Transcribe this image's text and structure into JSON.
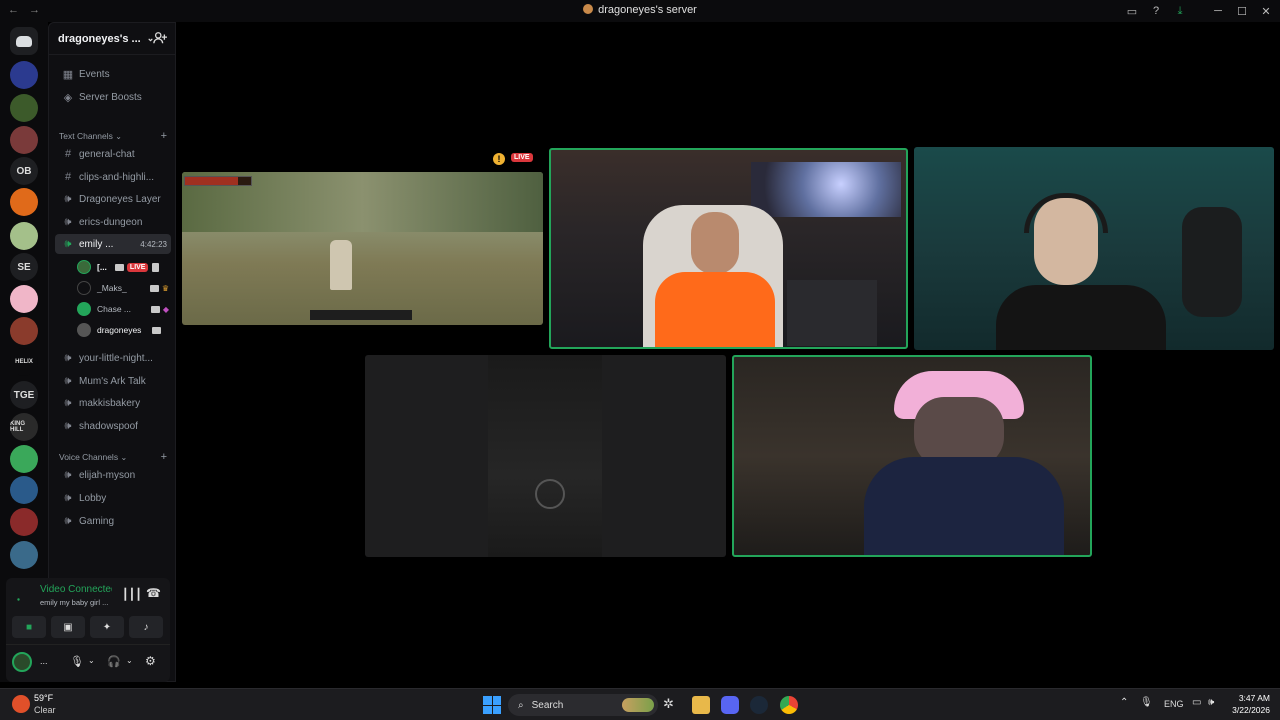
{
  "window": {
    "title": "dragoneyes's server",
    "back": "←",
    "forward": "→"
  },
  "guilds": [
    {
      "label": "",
      "color": "#5865f2"
    },
    {
      "label": "",
      "color": "#2b3a8f"
    },
    {
      "label": "",
      "color": "#3c5a2a"
    },
    {
      "label": "",
      "color": "#7a3a3a"
    },
    {
      "label": "OB",
      "color": "#1e1f22"
    },
    {
      "label": "",
      "color": "#e06a1a"
    },
    {
      "label": "",
      "color": "#a4c08a"
    },
    {
      "label": "SE",
      "color": "#1e1f22"
    },
    {
      "label": "",
      "color": "#f0b6c8"
    },
    {
      "label": "",
      "color": "#8a3b2c"
    },
    {
      "label": "HELIX",
      "color": "#0b0b0d"
    },
    {
      "label": "TGE",
      "color": "#1e1f22"
    },
    {
      "label": "KING HILL",
      "color": "#2a2a2a"
    },
    {
      "label": "",
      "color": "#3aa85a"
    },
    {
      "label": "",
      "color": "#2a5a8a"
    },
    {
      "label": "",
      "color": "#8a2a2a"
    },
    {
      "label": "",
      "color": "#3a6a8a"
    }
  ],
  "server": {
    "name": "dragoneyes's ...",
    "top_items": [
      "Events",
      "Server Boosts"
    ],
    "text_category": "Text Channels",
    "text_channels": [
      {
        "name": "general-chat",
        "type": "text"
      },
      {
        "name": "clips-and-highli...",
        "type": "text"
      },
      {
        "name": "Dragoneyes Layer",
        "type": "voice"
      },
      {
        "name": "erics-dungeon",
        "type": "voice"
      },
      {
        "name": "emily ...",
        "type": "voice",
        "timer": "4:42:23"
      }
    ],
    "voice_users": [
      {
        "name": "[...",
        "live": "LIVE",
        "color": "#3a6a3a"
      },
      {
        "name": "_Maks_",
        "color": "#444"
      },
      {
        "name": "Chase ...",
        "color": "#23a55a"
      },
      {
        "name": "dragoneyes",
        "color": "#555"
      }
    ],
    "more_channels": [
      {
        "name": "your-little-night...",
        "type": "voice"
      },
      {
        "name": "Mum's Ark Talk",
        "type": "voice"
      },
      {
        "name": "makkisbakery",
        "type": "voice"
      },
      {
        "name": "shadowspoof",
        "type": "voice"
      }
    ],
    "voice_category": "Voice Channels",
    "voice_channels": [
      "elijah-myson",
      "Lobby",
      "Gaming"
    ]
  },
  "voice_panel": {
    "status": "Video Connected",
    "sub": "emily my baby girl ..."
  },
  "user_panel": {
    "name": "..."
  },
  "stage": {
    "live_badge": "LIVE",
    "warn": "!"
  },
  "taskbar": {
    "weather_temp": "59°F",
    "weather_desc": "Clear",
    "search": "Search",
    "lang": "ENG",
    "time": "3:47 AM",
    "date": "3/22/2026"
  },
  "colors": {
    "accent": "#23a55a",
    "live": "#da373c",
    "speaking": "#23a55a"
  }
}
